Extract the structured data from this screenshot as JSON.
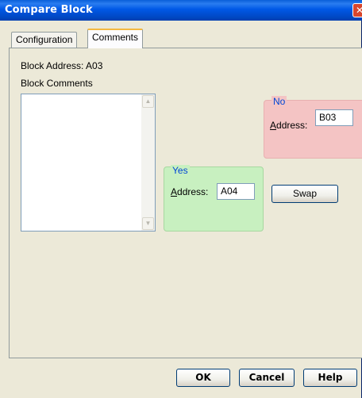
{
  "window": {
    "title": "Compare Block",
    "close_glyph": "✕"
  },
  "tabs": [
    {
      "label": "Configuration",
      "active": false
    },
    {
      "label": "Comments",
      "active": true
    }
  ],
  "block": {
    "address_label": "Block Address:",
    "address_value": "A03",
    "comments_label": "Block Comments",
    "comments_text": ""
  },
  "no_group": {
    "legend": "No",
    "address_label_accel": "A",
    "address_label_rest": "ddress:",
    "address_value": "B03",
    "color": "#f4c4c4"
  },
  "yes_group": {
    "legend": "Yes",
    "address_label_accel": "A",
    "address_label_rest": "ddress:",
    "address_value": "A04",
    "color": "#c8f0c0"
  },
  "buttons": {
    "swap": "Swap",
    "ok": "OK",
    "cancel": "Cancel",
    "help": "Help"
  }
}
